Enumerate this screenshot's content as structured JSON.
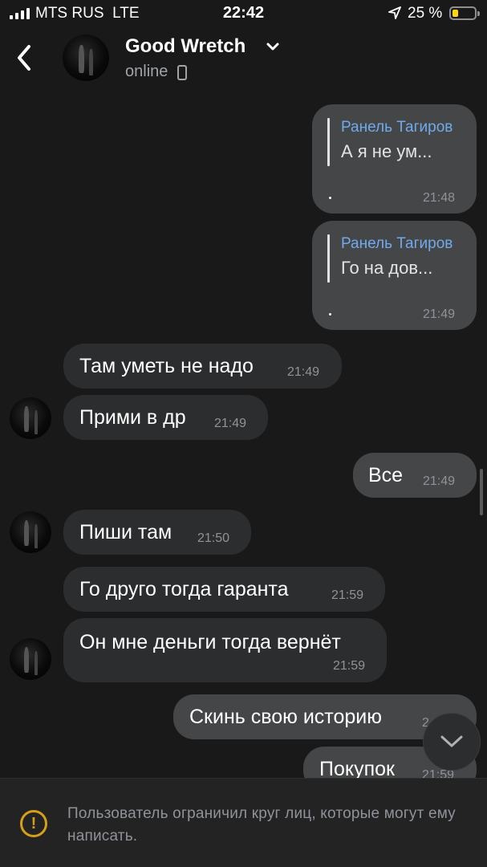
{
  "status_bar": {
    "carrier": "MTS RUS",
    "network": "LTE",
    "time": "22:42",
    "battery": "25 %",
    "battery_level": 0.25
  },
  "header": {
    "back_icon": "chevron-left-icon",
    "title": "Good Wretch",
    "status": "online",
    "title_dropdown_icon": "chevron-down-icon",
    "device_icon": "phone-icon"
  },
  "messages": [
    {
      "direction": "out",
      "reply_author": "Ранель Тагиров",
      "reply_text": "А я не ум...",
      "time": "21:48"
    },
    {
      "direction": "out",
      "reply_author": "Ранель Тагиров",
      "reply_text": "Го на дов...",
      "time": "21:49"
    },
    {
      "direction": "in",
      "text": "Там уметь не надо",
      "time": "21:49"
    },
    {
      "direction": "in",
      "text": "Прими в др",
      "time": "21:49"
    },
    {
      "direction": "out",
      "text": "Все",
      "time": "21:49"
    },
    {
      "direction": "in",
      "text": "Пиши там",
      "time": "21:50"
    },
    {
      "direction": "in",
      "text": "Го друго тогда гаранта",
      "time": "21:59"
    },
    {
      "direction": "in",
      "text": "Он мне деньги тогда вернёт",
      "time": "21:59"
    },
    {
      "direction": "out",
      "text": "Скинь свою историю",
      "time": "2"
    },
    {
      "direction": "out",
      "text": "Покупок",
      "time": "21:59"
    }
  ],
  "scroll_down_icon": "chevron-down-icon",
  "restriction": {
    "icon": "warning-icon",
    "text": "Пользователь ограничил круг лиц, которые могут ему написать."
  },
  "colors": {
    "background": "#19191a",
    "incoming_bubble": "#2c2d2e",
    "outgoing_bubble": "#454647",
    "reply_author": "#71aaeb",
    "warning": "#d4a017"
  }
}
